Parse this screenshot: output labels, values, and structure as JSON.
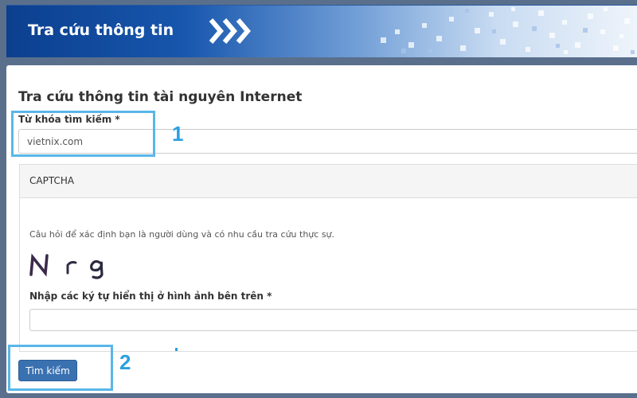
{
  "banner": {
    "title": "Tra cứu thông tin"
  },
  "page": {
    "title": "Tra cứu thông tin tài nguyên Internet"
  },
  "keyword": {
    "label": "Từ khóa tìm kiếm *",
    "value": "vietnix.com"
  },
  "captcha": {
    "header": "CAPTCHA",
    "question": "Câu hỏi để xác định bạn là người dùng và có nhu cầu tra cứu thực sự.",
    "image_text": "N r g",
    "input_label": "Nhập các ký tự hiển thị ở hình ảnh bên trên *",
    "input_value": ""
  },
  "search_button": {
    "label": "Tìm kiếm"
  },
  "annotations": [
    {
      "number": "1"
    },
    {
      "number": "2"
    }
  ],
  "colors": {
    "highlight": "#59b7e8",
    "button": "#3a71b1",
    "banner_dark": "#0c3f8e"
  }
}
